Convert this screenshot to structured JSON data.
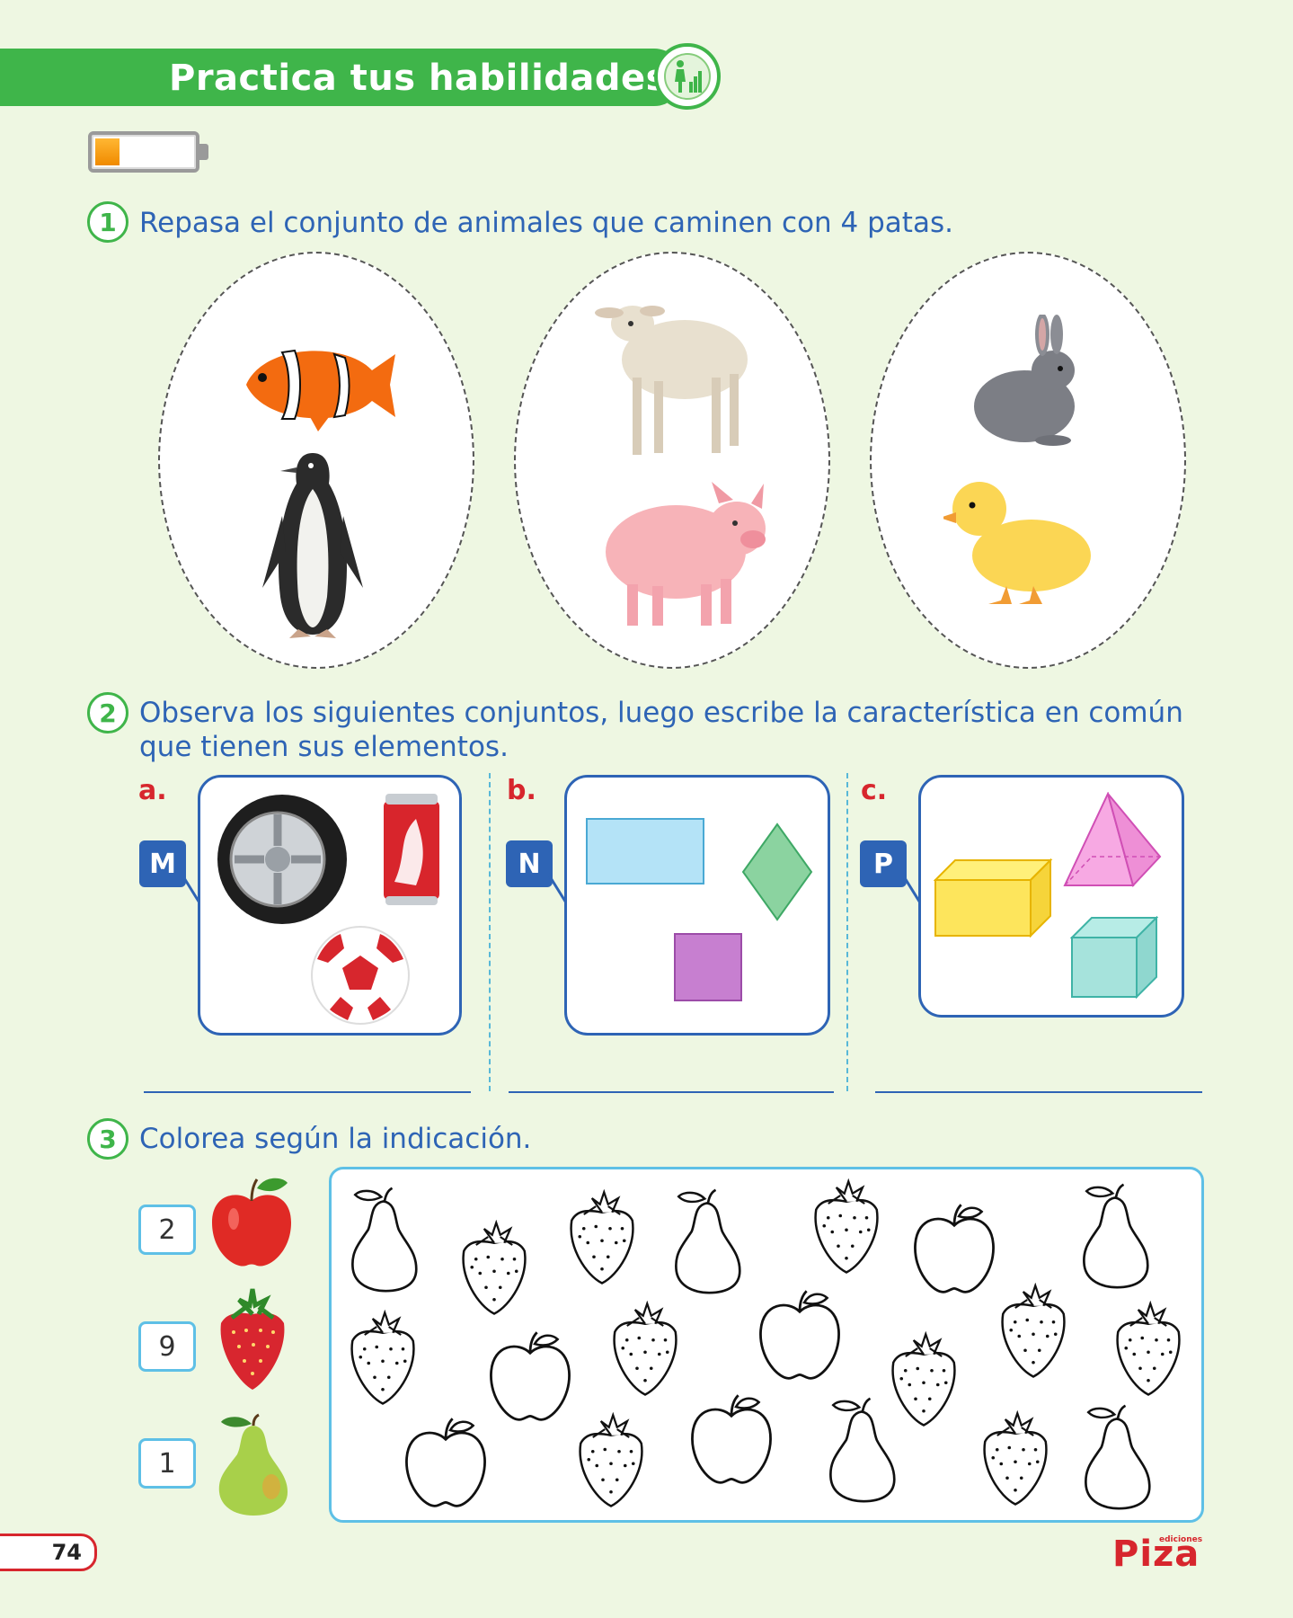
{
  "header": {
    "title": "Practica tus habilidades",
    "icon": "person-chart-icon"
  },
  "progress": {
    "level": 0.25,
    "accent": "#f08a00"
  },
  "q1": {
    "number": "1",
    "text": "Repasa el conjunto de animales que caminen con 4 patas.",
    "sets": [
      [
        "clownfish",
        "penguin"
      ],
      [
        "lamb",
        "pig"
      ],
      [
        "rabbit",
        "duckling"
      ]
    ]
  },
  "q2": {
    "number": "2",
    "text_line1": "Observa los siguientes conjuntos, luego escribe la característica en común",
    "text_line2": "que tienen sus elementos.",
    "sets": [
      {
        "letter": "a.",
        "tag": "M",
        "items": [
          "wheel",
          "soda-can",
          "soccer-ball"
        ]
      },
      {
        "letter": "b.",
        "tag": "N",
        "items": [
          "rectangle",
          "rhombus",
          "square"
        ]
      },
      {
        "letter": "c.",
        "tag": "P",
        "items": [
          "rectangular-prism",
          "pyramid",
          "cube"
        ]
      }
    ]
  },
  "q3": {
    "number": "3",
    "text": "Colorea según la indicación.",
    "legend": [
      {
        "count": "2",
        "fruit": "apple"
      },
      {
        "count": "9",
        "fruit": "strawberry"
      },
      {
        "count": "1",
        "fruit": "pear"
      }
    ]
  },
  "footer": {
    "page": "74",
    "brand": "Piza",
    "brand_small": "ediciones"
  },
  "colors": {
    "green": "#3fb54a",
    "blue": "#2e64b5",
    "red": "#d7262d",
    "cyan": "#5ec0e6"
  }
}
